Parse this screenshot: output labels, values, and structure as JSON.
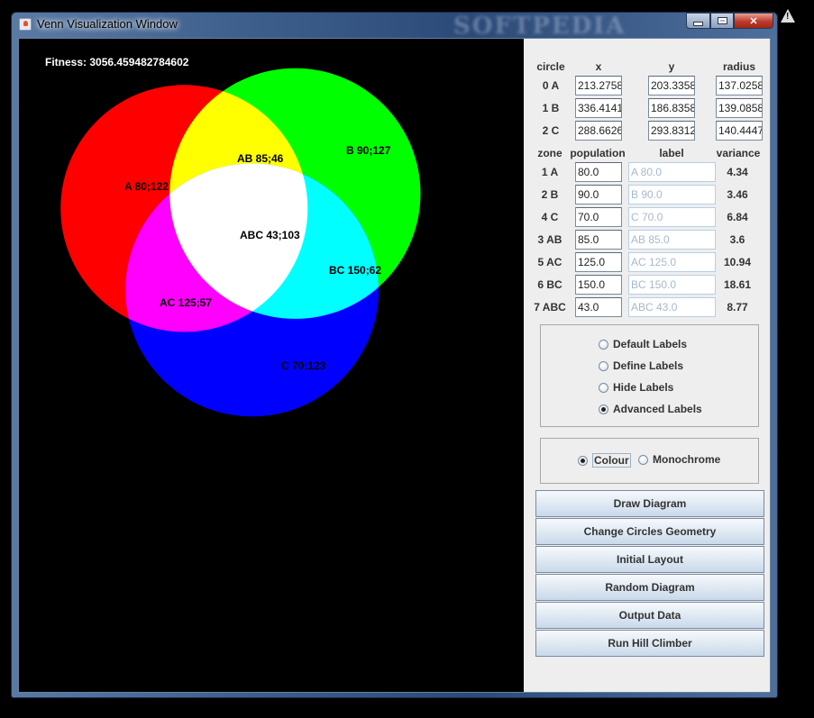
{
  "window": {
    "title": "Venn Visualization Window",
    "watermark": "SOFTPEDIA",
    "buttons": {
      "minimize": "minimize",
      "maximize": "maximize",
      "close": "✕"
    }
  },
  "canvas": {
    "fitness_label": "Fitness: 3056.459482784602",
    "colors": {
      "A": "#ff0000",
      "B": "#00ff00",
      "C": "#0000ff",
      "AB": "#ffff00",
      "AC": "#ff00ff",
      "BC": "#00ffff",
      "ABC": "#ffffff",
      "background": "#000000"
    },
    "zone_labels": {
      "A": "A 80;122",
      "B": "B 90;127",
      "C": "C 70;123",
      "AB": "AB 85;46",
      "AC": "AC 125;57",
      "BC": "BC 150;62",
      "ABC": "ABC 43;103"
    }
  },
  "circles": {
    "headers": {
      "circle": "circle",
      "x": "x",
      "y": "y",
      "radius": "radius"
    },
    "rows": [
      {
        "name": "0 A",
        "x": "213.2758",
        "y": "203.3358",
        "radius": "137.0258"
      },
      {
        "name": "1 B",
        "x": "336.4141",
        "y": "186.8358",
        "radius": "139.0858"
      },
      {
        "name": "2 C",
        "x": "288.6626",
        "y": "293.8312",
        "radius": "140.4447"
      }
    ]
  },
  "zones": {
    "headers": {
      "zone": "zone",
      "population": "population",
      "label": "label",
      "variance": "variance"
    },
    "rows": [
      {
        "zone": "1 A",
        "population": "80.0",
        "label": "A 80.0",
        "variance": "4.34"
      },
      {
        "zone": "2 B",
        "population": "90.0",
        "label": "B 90.0",
        "variance": "3.46"
      },
      {
        "zone": "4 C",
        "population": "70.0",
        "label": "C 70.0",
        "variance": "6.84"
      },
      {
        "zone": "3 AB",
        "population": "85.0",
        "label": "AB 85.0",
        "variance": "3.6"
      },
      {
        "zone": "5 AC",
        "population": "125.0",
        "label": "AC 125.0",
        "variance": "10.94"
      },
      {
        "zone": "6 BC",
        "population": "150.0",
        "label": "BC 150.0",
        "variance": "18.61"
      },
      {
        "zone": "7 ABC",
        "population": "43.0",
        "label": "ABC 43.0",
        "variance": "8.77"
      }
    ]
  },
  "label_options": {
    "items": [
      {
        "label": "Default Labels",
        "selected": false
      },
      {
        "label": "Define Labels",
        "selected": false
      },
      {
        "label": "Hide Labels",
        "selected": false
      },
      {
        "label": "Advanced Labels",
        "selected": true
      }
    ]
  },
  "color_options": {
    "items": [
      {
        "label": "Colour",
        "selected": true
      },
      {
        "label": "Monochrome",
        "selected": false
      }
    ]
  },
  "actions": [
    {
      "label": "Draw Diagram"
    },
    {
      "label": "Change Circles Geometry"
    },
    {
      "label": "Initial Layout"
    },
    {
      "label": "Random Diagram"
    },
    {
      "label": "Output Data"
    },
    {
      "label": "Run Hill Climber"
    }
  ]
}
